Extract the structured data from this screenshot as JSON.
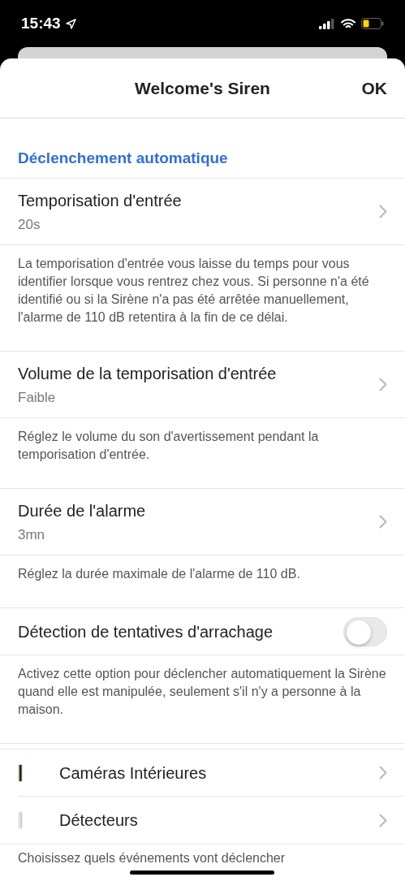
{
  "status_bar": {
    "time": "15:43"
  },
  "header": {
    "title": "Welcome's Siren",
    "action": "OK"
  },
  "section": {
    "title": "Déclenchement automatique"
  },
  "settings": [
    {
      "kind": "nav",
      "title": "Temporisation d'entrée",
      "value": "20s",
      "description": "La temporisation d'entrée vous laisse du temps pour vous identifier lorsque vous rentrez chez vous. Si personne n'a été identifié ou si la Sirène n'a pas été arrêtée manuellement, l'alarme de 110 dB retentira à la fin de ce délai."
    },
    {
      "kind": "nav",
      "title": "Volume de la temporisation d'entrée",
      "value": "Faible",
      "description": "Réglez le volume du son d'avertissement pendant la temporisation d'entrée."
    },
    {
      "kind": "nav",
      "title": "Durée de l'alarme",
      "value": "3mn",
      "description": "Réglez la durée maximale de l'alarme de 110 dB."
    },
    {
      "kind": "toggle",
      "title": "Détection de tentatives d'arrachage",
      "on": false,
      "description": "Activez cette option pour déclencher automatiquement la Sirène quand elle est manipulée, seulement s'il n'y a personne à la maison."
    }
  ],
  "devices": [
    {
      "kind": "camera",
      "label": "Caméras Intérieures"
    },
    {
      "kind": "sensor",
      "label": "Détecteurs"
    }
  ],
  "footer_text": "Choisissez quels événements vont déclencher"
}
